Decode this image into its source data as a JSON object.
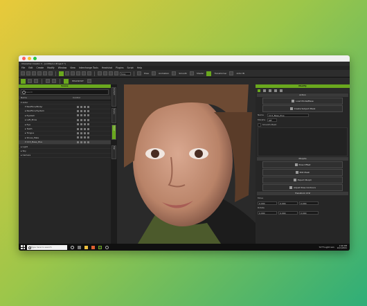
{
  "window": {
    "title": "Character Creator 3 - [untitled.ccProject *]"
  },
  "menu": [
    "File",
    "Edit",
    "Create",
    "Modify",
    "Window",
    "View",
    "Interchange Tools",
    "Headshot",
    "Plugins",
    "Script",
    "Help"
  ],
  "toolbar": {
    "zoom_value": "Fully",
    "headshot_label": "HEADSHOT",
    "buttons": [
      "Pose",
      "Animation",
      "Smooth",
      "Shader",
      "Transformer",
      "Actor Bl"
    ]
  },
  "scene": {
    "header": "Scene",
    "search_placeholder": "Search",
    "columns": [
      "Name",
      "Control"
    ],
    "tree": [
      {
        "name": "▾ Actor",
        "level": 0,
        "selected": false
      },
      {
        "name": "▾ RealFace/Body/",
        "level": 1,
        "selected": false
      },
      {
        "name": "▸ RealFace/System",
        "level": 1,
        "selected": false
      },
      {
        "name": "▸ Eyelash",
        "level": 1,
        "selected": false
      },
      {
        "name": "▸ Left_Brow",
        "level": 1,
        "selected": false
      },
      {
        "name": "▸ Eye",
        "level": 1,
        "selected": false
      },
      {
        "name": "▸ Teeth",
        "level": 1,
        "selected": false
      },
      {
        "name": "▸ Tongue",
        "level": 1,
        "selected": false
      },
      {
        "name": "▸ Shoes_Male",
        "level": 1,
        "selected": false
      },
      {
        "name": "▾ CC3_Base_Plus",
        "level": 1,
        "selected": true
      },
      {
        "name": "▸ Light",
        "level": 0,
        "selected": false
      },
      {
        "name": "▸ Sky",
        "level": 0,
        "selected": false
      },
      {
        "name": "▸ Camera",
        "level": 0,
        "selected": false
      }
    ]
  },
  "side_tabs": [
    "Content",
    "Scene",
    "Visual",
    "Hair"
  ],
  "modify": {
    "header": "Modify",
    "action_section": "Action",
    "action_buttons": [
      "Load Model/Base",
      "Create Subject Mask"
    ],
    "name_label": "Name",
    "name_value": "CC3_Base_Plus",
    "morphs_label": "Morphs",
    "morphs_toggle": "Off",
    "smooth_label": "Smooth Mesh",
    "morph_section": "Morphs",
    "morph_buttons": [
      "Pose Offset",
      "Edit Mesh",
      "Export Morph",
      "Adjust Pose Contours"
    ],
    "transform_section": "Transform XYZ",
    "move_label": "Move",
    "move_values": [
      "0.000",
      "0.000",
      "0.000"
    ],
    "rotate_label": "Rotate",
    "rotate_values": [
      "0.000",
      "0.000",
      "0.000"
    ]
  },
  "taskbar": {
    "search_placeholder": "Type here to search",
    "weather": "72°F Light rain",
    "time": "2:46 PM",
    "date": "12/1/2021"
  },
  "colors": {
    "accent": "#6aa81e",
    "panel": "#262626"
  }
}
